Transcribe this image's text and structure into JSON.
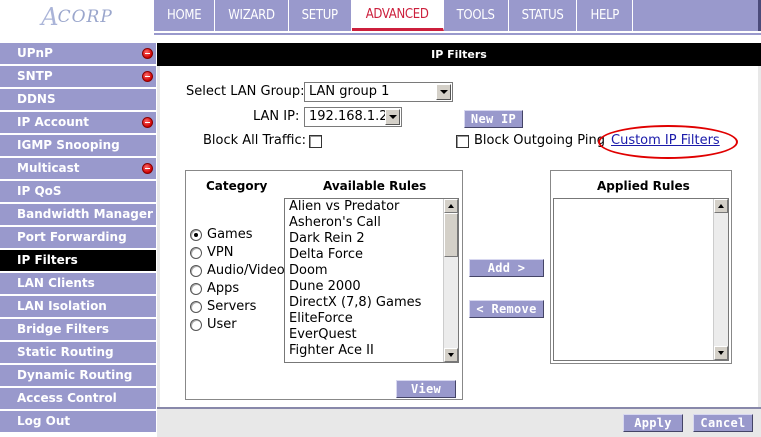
{
  "logo": {
    "text": "CORP",
    "initial": "A"
  },
  "nav": {
    "items": [
      "HOME",
      "WIZARD",
      "SETUP",
      "ADVANCED",
      "TOOLS",
      "STATUS",
      "HELP"
    ],
    "active": "ADVANCED"
  },
  "sidebar": {
    "items": [
      {
        "label": "UPnP",
        "alert": true
      },
      {
        "label": "SNTP",
        "alert": true
      },
      {
        "label": "DDNS",
        "alert": false
      },
      {
        "label": "IP Account",
        "alert": true
      },
      {
        "label": "IGMP Snooping",
        "alert": false
      },
      {
        "label": "Multicast",
        "alert": true
      },
      {
        "label": "IP QoS",
        "alert": false
      },
      {
        "label": "Bandwidth Manager",
        "alert": false
      },
      {
        "label": "Port Forwarding",
        "alert": false
      },
      {
        "label": "IP Filters",
        "alert": false
      },
      {
        "label": "LAN Clients",
        "alert": false
      },
      {
        "label": "LAN Isolation",
        "alert": false
      },
      {
        "label": "Bridge Filters",
        "alert": false
      },
      {
        "label": "Static Routing",
        "alert": false
      },
      {
        "label": "Dynamic Routing",
        "alert": false
      },
      {
        "label": "Access Control",
        "alert": false
      },
      {
        "label": "Log Out",
        "alert": false
      }
    ],
    "active": "IP Filters"
  },
  "panel": {
    "title": "IP Filters",
    "select_lan_group_label": "Select LAN Group:",
    "select_lan_group_value": "LAN group 1",
    "lan_ip_label": "LAN IP:",
    "lan_ip_value": "192.168.1.2",
    "new_ip_button": "New IP",
    "block_all_traffic_label": "Block All Traffic:",
    "block_outgoing_ping_label": "Block Outgoing Ping",
    "custom_ip_filters_link": "Custom IP Filters",
    "category_header": "Category",
    "available_rules_header": "Available Rules",
    "applied_rules_header": "Applied Rules",
    "categories": [
      {
        "label": "Games",
        "selected": true
      },
      {
        "label": "VPN",
        "selected": false
      },
      {
        "label": "Audio/Video",
        "selected": false
      },
      {
        "label": "Apps",
        "selected": false
      },
      {
        "label": "Servers",
        "selected": false
      },
      {
        "label": "User",
        "selected": false
      }
    ],
    "available_rules": [
      "Alien vs Predator",
      "Asheron's Call",
      "Dark Rein 2",
      "Delta Force",
      "Doom",
      "Dune 2000",
      "DirectX (7,8) Games",
      "EliteForce",
      "EverQuest",
      "Fighter Ace II"
    ],
    "add_button": "Add >",
    "remove_button": "< Remove",
    "view_button": "View",
    "apply_button": "Apply",
    "cancel_button": "Cancel"
  },
  "colors": {
    "nav_bg": "#9999cc",
    "active_red": "#cc1f3c",
    "highlight_oval": "#e00000"
  }
}
